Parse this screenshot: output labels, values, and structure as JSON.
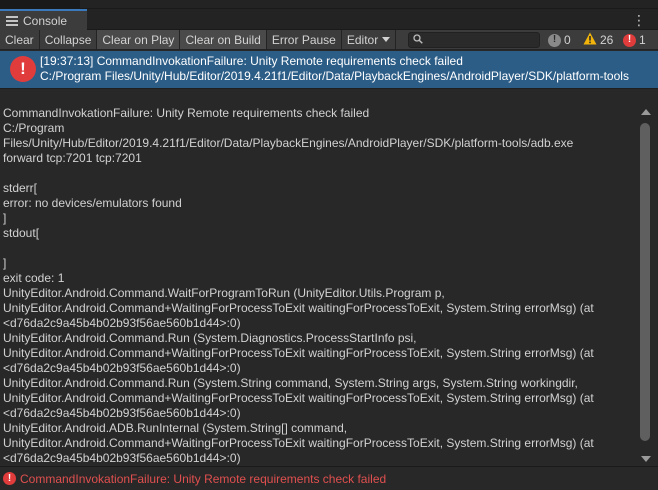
{
  "tab": {
    "label": "Console"
  },
  "toolbar": {
    "buttons": [
      {
        "label": "Clear",
        "active": false
      },
      {
        "label": "Collapse",
        "active": false
      },
      {
        "label": "Clear on Play",
        "active": true
      },
      {
        "label": "Clear on Build",
        "active": true
      },
      {
        "label": "Error Pause",
        "active": false
      }
    ],
    "editor_label": "Editor",
    "search_value": "",
    "info_count": "0",
    "warning_count": "26",
    "error_count": "1"
  },
  "colors": {
    "accent": "#3a79bb",
    "selected_row": "#2c5d87",
    "error": "#e03c3c",
    "warning": "#f2b40a",
    "info": "#8a8a8a",
    "error_text": "#e04f4f"
  },
  "selected_entry": {
    "line1": "[19:37:13] CommandInvokationFailure: Unity Remote requirements check failed",
    "line2": "C:/Program Files/Unity/Hub/Editor/2019.4.21f1/Editor/Data/PlaybackEngines/AndroidPlayer/SDK/platform-tools"
  },
  "detail_lines": [
    "CommandInvokationFailure: Unity Remote requirements check failed",
    "C:/Program",
    "Files/Unity/Hub/Editor/2019.4.21f1/Editor/Data/PlaybackEngines/AndroidPlayer/SDK/platform-tools/adb.exe",
    "forward tcp:7201 tcp:7201",
    "",
    "stderr[",
    "error: no devices/emulators found",
    "]",
    "stdout[",
    "",
    "]",
    "exit code: 1",
    "UnityEditor.Android.Command.WaitForProgramToRun (UnityEditor.Utils.Program p,",
    "UnityEditor.Android.Command+WaitingForProcessToExit waitingForProcessToExit, System.String errorMsg) (at",
    "<d76da2c9a45b4b02b93f56ae560b1d44>:0)",
    "UnityEditor.Android.Command.Run (System.Diagnostics.ProcessStartInfo psi,",
    "UnityEditor.Android.Command+WaitingForProcessToExit waitingForProcessToExit, System.String errorMsg) (at",
    "<d76da2c9a45b4b02b93f56ae560b1d44>:0)",
    "UnityEditor.Android.Command.Run (System.String command, System.String args, System.String workingdir,",
    "UnityEditor.Android.Command+WaitingForProcessToExit waitingForProcessToExit, System.String errorMsg) (at",
    "<d76da2c9a45b4b02b93f56ae560b1d44>:0)",
    "UnityEditor.Android.ADB.RunInternal (System.String[] command,",
    "UnityEditor.Android.Command+WaitingForProcessToExit waitingForProcessToExit, System.String errorMsg) (at",
    "<d76da2c9a45b4b02b93f56ae560b1d44>:0)"
  ],
  "status_bar": {
    "message": "CommandInvokationFailure: Unity Remote requirements check failed"
  },
  "icons": {
    "tab": "console-list-icon",
    "menu": "kebab-menu-icon",
    "search": "search-icon",
    "info": "info-icon",
    "warning": "warning-icon",
    "error": "error-icon"
  }
}
